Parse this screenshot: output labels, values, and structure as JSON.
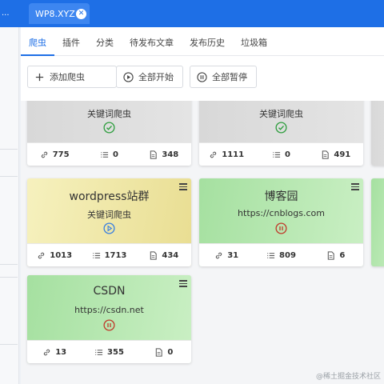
{
  "window": {
    "left_tab_label": "...",
    "active_tab_label": "WP8.XYZ",
    "close_glyph": "✕"
  },
  "tabs": [
    {
      "label": "爬虫",
      "active": true
    },
    {
      "label": "插件",
      "active": false
    },
    {
      "label": "分类",
      "active": false
    },
    {
      "label": "待发布文章",
      "active": false
    },
    {
      "label": "发布历史",
      "active": false
    },
    {
      "label": "垃圾箱",
      "active": false
    }
  ],
  "toolbar": {
    "add_label": "添加爬虫",
    "start_all_label": "全部开始",
    "pause_all_label": "全部暂停"
  },
  "cards": [
    {
      "title": "",
      "subtitle": "关键词爬虫",
      "status": "done",
      "links": "775",
      "list": "0",
      "docs": "348",
      "theme": "gray"
    },
    {
      "title": "",
      "subtitle": "关键词爬虫",
      "status": "done",
      "links": "1111",
      "list": "0",
      "docs": "491",
      "theme": "gray"
    },
    {
      "title": "wordpress站群",
      "subtitle": "关键词爬虫",
      "status": "play",
      "links": "1013",
      "list": "1713",
      "docs": "434",
      "theme": "yellow"
    },
    {
      "title": "博客园",
      "subtitle": "https://cnblogs.com",
      "status": "pause",
      "links": "31",
      "list": "809",
      "docs": "6",
      "theme": "green"
    },
    {
      "title": "CSDN",
      "subtitle": "https://csdn.net",
      "status": "pause",
      "links": "13",
      "list": "355",
      "docs": "0",
      "theme": "green"
    }
  ],
  "colors": {
    "accent": "#1e6fe6",
    "done": "#2e9e3e",
    "play": "#3a7fe0",
    "pause": "#c0392b"
  },
  "watermark": "@稀土掘金技术社区"
}
